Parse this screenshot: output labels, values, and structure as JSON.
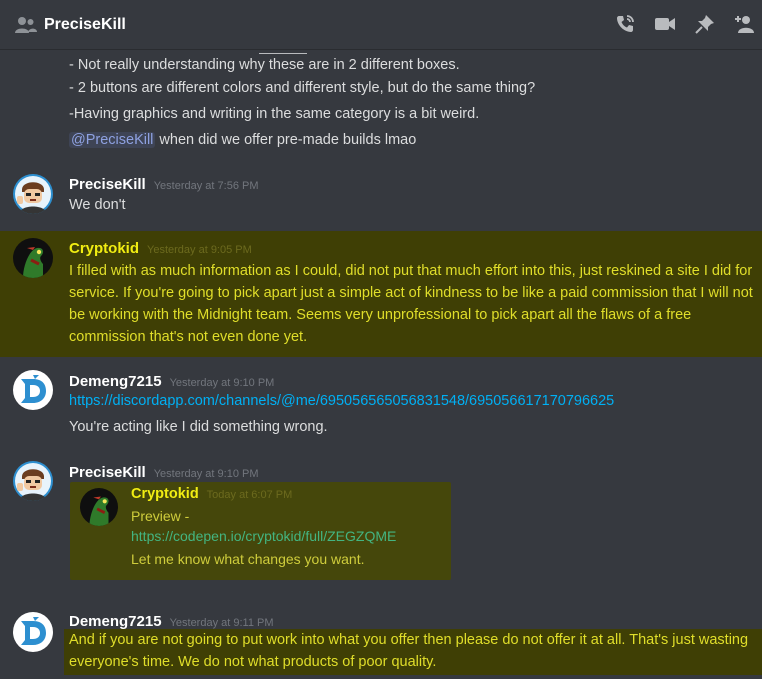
{
  "header": {
    "channel_name": "PreciseKill",
    "icons": [
      "at-people-icon",
      "phone-call-icon",
      "video-icon",
      "pin-icon",
      "add-member-icon"
    ]
  },
  "messages_top": {
    "lines": [
      "- Not really understanding why these are in 2 different boxes.",
      "- 2 buttons are different colors and different style, but do the same thing?",
      "-Having graphics and writing in the same category is a bit weird."
    ],
    "mention": "@PreciseKill",
    "mention_suffix": " when did we offer pre-made builds lmao"
  },
  "messages": [
    {
      "author": "PreciseKill",
      "time": "Yesterday at 7:56 PM",
      "text": "We don't"
    },
    {
      "author": "Cryptokid",
      "time": "Yesterday at 9:05 PM",
      "text": "I filled with as much information as I could, did not put that much effort into this, just reskined a site I did for service. If you're going to pick apart just a simple act of kindness to be like a paid commission that I will not be working with the Midnight team. Seems very unprofessional to pick apart all the flaws of a free commission that's not even done yet."
    },
    {
      "author": "Demeng7215",
      "time": "Yesterday at 9:10 PM",
      "link": "https://discordapp.com/channels/@me/695056565056831548/695056617170796625",
      "text": "You're acting like I did something wrong."
    },
    {
      "author": "PreciseKill",
      "time": "Yesterday at 9:10 PM",
      "quote": {
        "author": "Cryptokid",
        "time": "Today at 6:07 PM",
        "preview_label": "Preview - ",
        "preview_link": "https://codepen.io/cryptokid/full/ZEGZQME",
        "note": "Let me know what changes you want."
      }
    },
    {
      "author": "Demeng7215",
      "time": "Yesterday at 9:11 PM",
      "text": "And if you are not going to put work into what you offer then please do not offer it at all. That's just wasting everyone's time. We do not what products of poor quality."
    }
  ],
  "colors": {
    "background": "#36393f",
    "highlight": "#3f3f05",
    "highlight_text": "#e0de2a",
    "link": "#00b0f4",
    "mention": "#8ea1e1"
  }
}
